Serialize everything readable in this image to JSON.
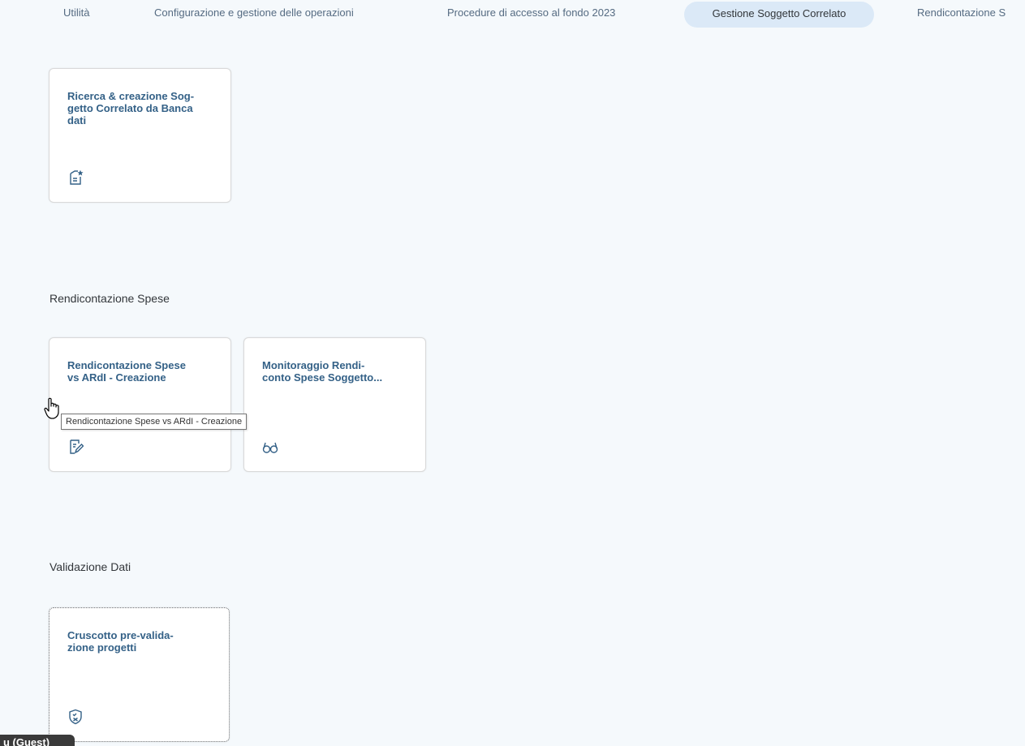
{
  "topnav": {
    "tabs": [
      {
        "label": "Utilità"
      },
      {
        "label": "Configurazione e gestione delle operazioni"
      },
      {
        "label": "Procedure di accesso al fondo 2023"
      },
      {
        "label": "Gestione Soggetto Correlato",
        "active": true
      },
      {
        "label": "Rendicontazione S"
      }
    ]
  },
  "sections": {
    "soggetto": {
      "tiles": [
        {
          "title": "Ricerca & creazione Sog-\ngetto Correlato da Banca\ndati",
          "icon": "document-star-icon"
        }
      ]
    },
    "rendicontazione": {
      "title": "Rendicontazione Spese",
      "tiles": [
        {
          "title": "Rendicontazione Spese\nvs ARdI - Creazione",
          "icon": "document-edit-icon"
        },
        {
          "title": "Monitoraggio Rendi-\nconto Spese Soggetto...",
          "icon": "glasses-icon"
        }
      ]
    },
    "validazione": {
      "title": "Validazione Dati",
      "tiles": [
        {
          "title": "Cruscotto pre-valida-\nzione progetti",
          "icon": "shield-check-icon"
        }
      ]
    }
  },
  "tooltip": {
    "text": "Rendicontazione Spese vs ARdI - Creazione"
  },
  "guest_badge": {
    "text": "u (Guest)"
  },
  "colors": {
    "background": "#f5f9fc",
    "tile_title": "#346187",
    "active_tab": "#dbe9f7"
  }
}
